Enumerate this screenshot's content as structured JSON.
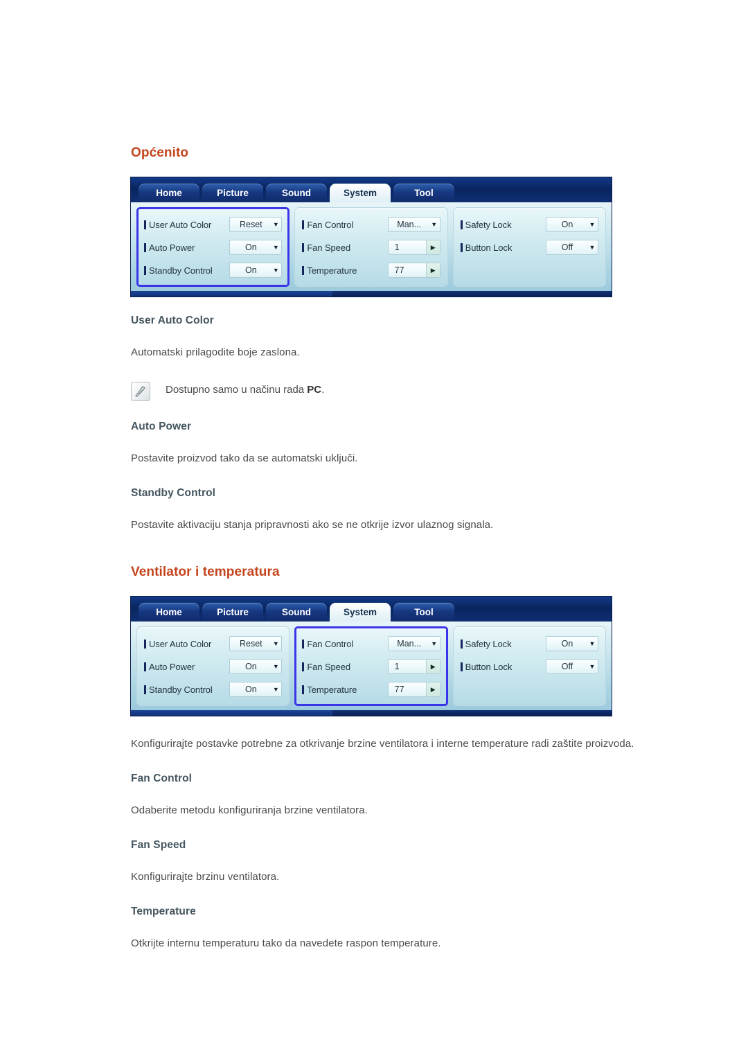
{
  "sections": [
    {
      "title": "Općenito",
      "osd": {
        "tabs": [
          {
            "label": "Home",
            "active": false
          },
          {
            "label": "Picture",
            "active": false
          },
          {
            "label": "Sound",
            "active": false
          },
          {
            "label": "System",
            "active": true
          },
          {
            "label": "Tool",
            "active": false
          }
        ],
        "columns": [
          {
            "highlighted": true,
            "rows": [
              {
                "label": "User Auto Color",
                "value": "Reset",
                "control": "dropdown"
              },
              {
                "label": "Auto Power",
                "value": "On",
                "control": "dropdown"
              },
              {
                "label": "Standby Control",
                "value": "On",
                "control": "dropdown"
              }
            ]
          },
          {
            "highlighted": false,
            "rows": [
              {
                "label": "Fan Control",
                "value": "Man...",
                "control": "dropdown"
              },
              {
                "label": "Fan Speed",
                "value": "1",
                "control": "spinner"
              },
              {
                "label": "Temperature",
                "value": "77",
                "control": "spinner"
              }
            ]
          },
          {
            "highlighted": false,
            "rows": [
              {
                "label": "Safety Lock",
                "value": "On",
                "control": "dropdown"
              },
              {
                "label": "Button Lock",
                "value": "Off",
                "control": "dropdown"
              }
            ]
          }
        ]
      },
      "blocks": [
        {
          "kind": "subtitle",
          "text": "User Auto Color"
        },
        {
          "kind": "paragraph",
          "text": "Automatski prilagodite boje zaslona."
        },
        {
          "kind": "note",
          "text_before": "Dostupno samo u načinu rada ",
          "emphasis": "PC",
          "text_after": ".",
          "icon": "note-pen-icon"
        },
        {
          "kind": "subtitle",
          "text": "Auto Power"
        },
        {
          "kind": "paragraph",
          "text": "Postavite proizvod tako da se automatski uključi."
        },
        {
          "kind": "subtitle",
          "text": "Standby Control"
        },
        {
          "kind": "paragraph",
          "text": "Postavite aktivaciju stanja pripravnosti ako se ne otkrije izvor ulaznog signala."
        }
      ]
    },
    {
      "title": "Ventilator i temperatura",
      "osd": {
        "tabs": [
          {
            "label": "Home",
            "active": false
          },
          {
            "label": "Picture",
            "active": false
          },
          {
            "label": "Sound",
            "active": false
          },
          {
            "label": "System",
            "active": true
          },
          {
            "label": "Tool",
            "active": false
          }
        ],
        "columns": [
          {
            "highlighted": false,
            "rows": [
              {
                "label": "User Auto Color",
                "value": "Reset",
                "control": "dropdown"
              },
              {
                "label": "Auto Power",
                "value": "On",
                "control": "dropdown"
              },
              {
                "label": "Standby Control",
                "value": "On",
                "control": "dropdown"
              }
            ]
          },
          {
            "highlighted": true,
            "rows": [
              {
                "label": "Fan Control",
                "value": "Man...",
                "control": "dropdown"
              },
              {
                "label": "Fan Speed",
                "value": "1",
                "control": "spinner"
              },
              {
                "label": "Temperature",
                "value": "77",
                "control": "spinner"
              }
            ]
          },
          {
            "highlighted": false,
            "rows": [
              {
                "label": "Safety Lock",
                "value": "On",
                "control": "dropdown"
              },
              {
                "label": "Button Lock",
                "value": "Off",
                "control": "dropdown"
              }
            ]
          }
        ]
      },
      "blocks": [
        {
          "kind": "paragraph",
          "text": "Konfigurirajte postavke potrebne za otkrivanje brzine ventilatora i interne temperature radi zaštite proizvoda."
        },
        {
          "kind": "subtitle",
          "text": "Fan Control"
        },
        {
          "kind": "paragraph",
          "text": "Odaberite metodu konfiguriranja brzine ventilatora."
        },
        {
          "kind": "subtitle",
          "text": "Fan Speed"
        },
        {
          "kind": "paragraph",
          "text": "Konfigurirajte brzinu ventilatora."
        },
        {
          "kind": "subtitle",
          "text": "Temperature"
        },
        {
          "kind": "paragraph",
          "text": "Otkrijte internu temperaturu tako da navedete raspon temperature."
        }
      ]
    }
  ],
  "glyphs": {
    "caret_down": "▼",
    "caret_right": "▶"
  },
  "colors": {
    "heading": "#c4441c",
    "subheading": "#44555f",
    "body": "#4a4a4a",
    "highlight_border": "#3a35e8",
    "osd_chrome": "#0d2f72"
  }
}
